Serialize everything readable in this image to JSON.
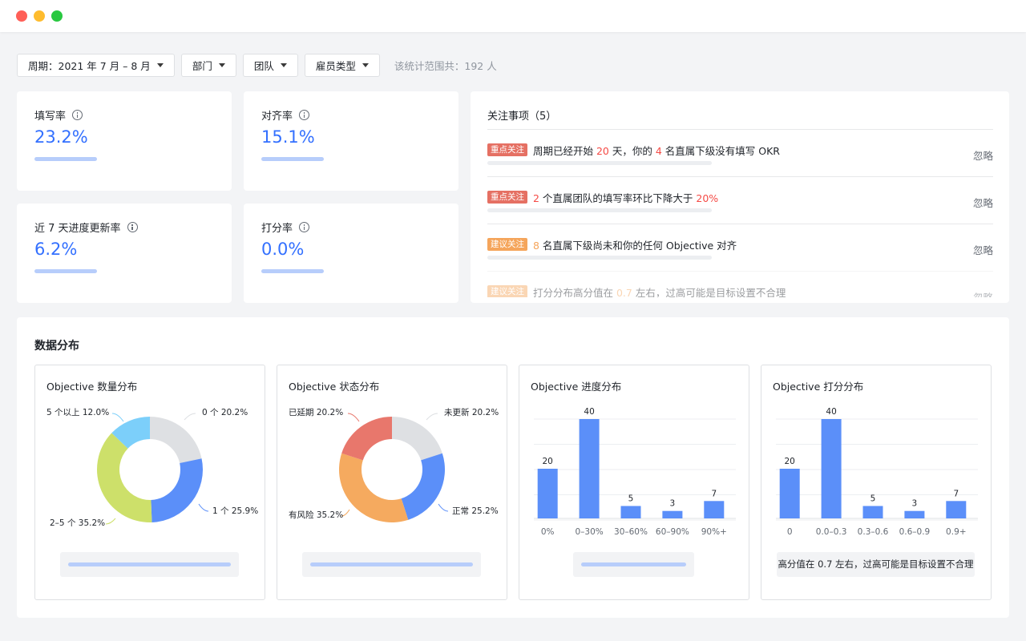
{
  "filters": {
    "period_label": "周期：2021 年 7 月 – 8 月",
    "department_label": "部门",
    "team_label": "团队",
    "employee_type_label": "雇员类型",
    "range_text": "该统计范围共：192 人"
  },
  "kpis": [
    {
      "title": "填写率",
      "value": "23.2%"
    },
    {
      "title": "对齐率",
      "value": "15.1%"
    },
    {
      "title": "近 7 天进度更新率",
      "value": "6.2%"
    },
    {
      "title": "打分率",
      "value": "0.0%"
    }
  ],
  "focus": {
    "title": "关注事项（5）",
    "ignore_label": "忽略",
    "items": [
      {
        "tag": "重点关注",
        "tag_level": "red",
        "parts": [
          {
            "t": "周期已经开始 ",
            "hl": ""
          },
          {
            "t": "20",
            "hl": "red"
          },
          {
            "t": " 天，你的 ",
            "hl": ""
          },
          {
            "t": "4",
            "hl": "red"
          },
          {
            "t": " 名直属下级没有填写 OKR",
            "hl": ""
          }
        ]
      },
      {
        "tag": "重点关注",
        "tag_level": "red",
        "parts": [
          {
            "t": "2",
            "hl": "red"
          },
          {
            "t": " 个直属团队的填写率环比下降大于 ",
            "hl": ""
          },
          {
            "t": "20%",
            "hl": "red"
          }
        ]
      },
      {
        "tag": "建议关注",
        "tag_level": "orange",
        "parts": [
          {
            "t": "8",
            "hl": "orange"
          },
          {
            "t": " 名直属下级尚未和你的任何 Objective 对齐",
            "hl": ""
          }
        ]
      },
      {
        "tag": "建议关注",
        "tag_level": "orange",
        "parts": [
          {
            "t": "打分分布高分值在 ",
            "hl": ""
          },
          {
            "t": "0.7",
            "hl": "orange"
          },
          {
            "t": " 左右，过高可能是目标设置不合理",
            "hl": ""
          }
        ]
      }
    ]
  },
  "distribution": {
    "title": "数据分布",
    "charts": [
      {
        "title": "Objective 数量分布"
      },
      {
        "title": "Objective 状态分布"
      },
      {
        "title": "Objective 进度分布"
      },
      {
        "title": "Objective 打分分布",
        "note": "高分值在 0.7 左右，过高可能是目标设置不合理"
      }
    ]
  },
  "chart_data": [
    {
      "type": "pie",
      "title": "Objective 数量分布",
      "slices": [
        {
          "label": "0 个 20.2%",
          "value": 20.2,
          "color": "#dee0e3"
        },
        {
          "label": "1 个 25.9%",
          "value": 25.9,
          "color": "#5b8ff9"
        },
        {
          "label": "2–5 个 35.2%",
          "value": 35.2,
          "color": "#cde06a"
        },
        {
          "label": "5 个以上 12.0%",
          "value": 12.0,
          "color": "#7ccffa"
        }
      ]
    },
    {
      "type": "pie",
      "title": "Objective 状态分布",
      "slices": [
        {
          "label": "未更新 20.2%",
          "value": 20.2,
          "color": "#dee0e3"
        },
        {
          "label": "正常 25.2%",
          "value": 25.2,
          "color": "#5b8ff9"
        },
        {
          "label": "有风险 35.2%",
          "value": 35.2,
          "color": "#f5aa5f"
        },
        {
          "label": "已延期 20.2%",
          "value": 20.2,
          "color": "#e8776c"
        }
      ]
    },
    {
      "type": "bar",
      "title": "Objective 进度分布",
      "categories": [
        "0%",
        "0–30%",
        "30–60%",
        "60–90%",
        "90%+"
      ],
      "values": [
        20,
        40,
        5,
        3,
        7
      ],
      "ylim": [
        0,
        40
      ],
      "color": "#5b8ff9"
    },
    {
      "type": "bar",
      "title": "Objective 打分分布",
      "categories": [
        "0",
        "0.0–0.3",
        "0.3–0.6",
        "0.6–0.9",
        "0.9+"
      ],
      "values": [
        20,
        40,
        5,
        3,
        7
      ],
      "ylim": [
        0,
        40
      ],
      "color": "#5b8ff9"
    }
  ]
}
